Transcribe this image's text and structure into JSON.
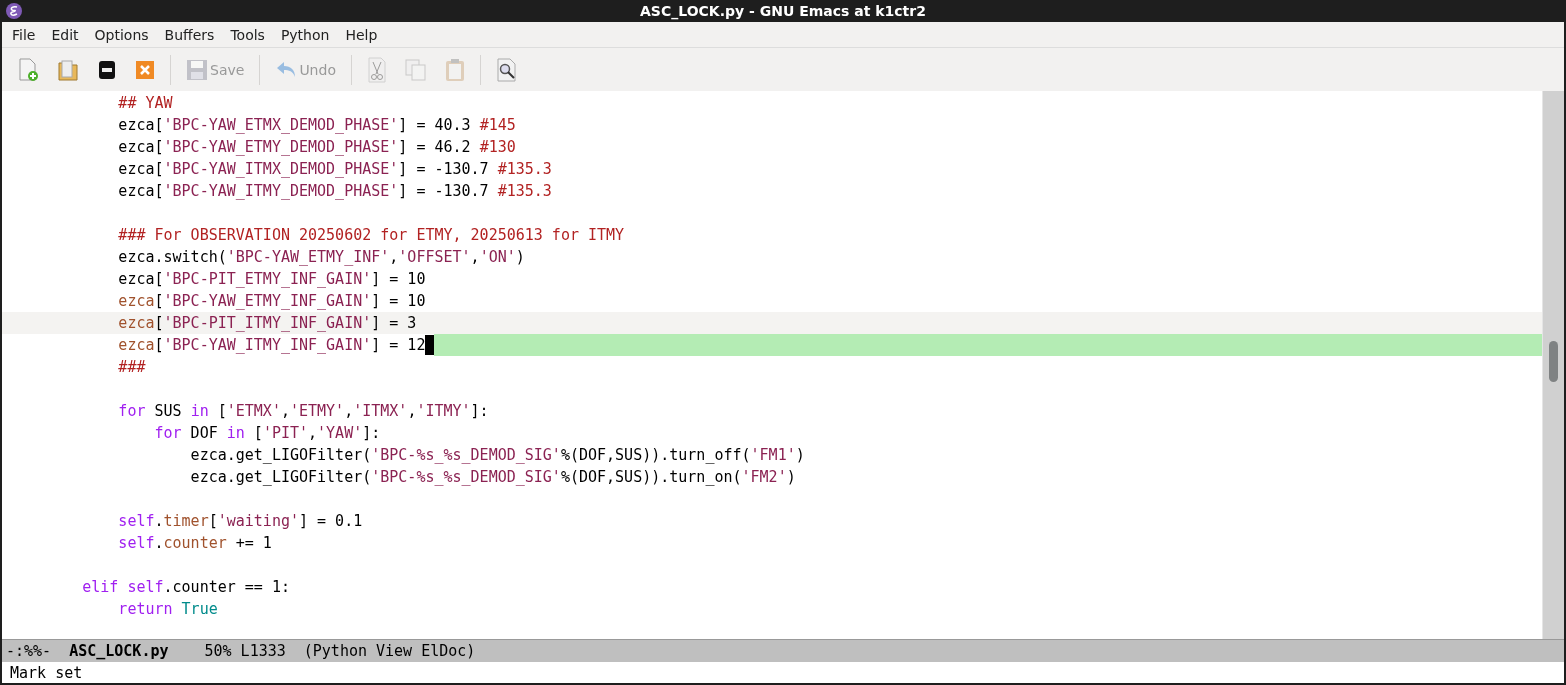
{
  "window": {
    "title": "ASC_LOCK.py - GNU Emacs at k1ctr2"
  },
  "menu": [
    "File",
    "Edit",
    "Options",
    "Buffers",
    "Tools",
    "Python",
    "Help"
  ],
  "toolbar": [
    {
      "kind": "new-file",
      "disabled": false
    },
    {
      "kind": "open",
      "disabled": false
    },
    {
      "kind": "dired",
      "disabled": false
    },
    {
      "kind": "close",
      "disabled": false
    },
    {
      "kind": "sep"
    },
    {
      "kind": "save",
      "label": "Save",
      "disabled": true
    },
    {
      "kind": "sep"
    },
    {
      "kind": "undo",
      "label": "Undo",
      "disabled": true
    },
    {
      "kind": "sep"
    },
    {
      "kind": "cut",
      "disabled": true
    },
    {
      "kind": "copy",
      "disabled": true
    },
    {
      "kind": "paste",
      "disabled": true
    },
    {
      "kind": "sep"
    },
    {
      "kind": "search",
      "disabled": false
    }
  ],
  "lines": [
    {
      "kind": "code",
      "tokens": [
        {
          "kind": "comment",
          "text": "            ## YAW"
        }
      ]
    },
    {
      "kind": "code",
      "tokens": [
        {
          "kind": "plain",
          "text": "            ezca["
        },
        {
          "kind": "string",
          "text": "'BPC-YAW_ETMX_DEMOD_PHASE'"
        },
        {
          "kind": "plain",
          "text": "] = 40.3 "
        },
        {
          "kind": "comment",
          "text": "#145"
        }
      ]
    },
    {
      "kind": "code",
      "tokens": [
        {
          "kind": "plain",
          "text": "            ezca["
        },
        {
          "kind": "string",
          "text": "'BPC-YAW_ETMY_DEMOD_PHASE'"
        },
        {
          "kind": "plain",
          "text": "] = 46.2 "
        },
        {
          "kind": "comment",
          "text": "#130"
        }
      ]
    },
    {
      "kind": "code",
      "tokens": [
        {
          "kind": "plain",
          "text": "            ezca["
        },
        {
          "kind": "string",
          "text": "'BPC-YAW_ITMX_DEMOD_PHASE'"
        },
        {
          "kind": "plain",
          "text": "] = -130.7 "
        },
        {
          "kind": "comment",
          "text": "#135.3"
        }
      ]
    },
    {
      "kind": "code",
      "tokens": [
        {
          "kind": "plain",
          "text": "            ezca["
        },
        {
          "kind": "string",
          "text": "'BPC-YAW_ITMY_DEMOD_PHASE'"
        },
        {
          "kind": "plain",
          "text": "] = -130.7 "
        },
        {
          "kind": "comment",
          "text": "#135.3"
        }
      ]
    },
    {
      "kind": "blank"
    },
    {
      "kind": "code",
      "tokens": [
        {
          "kind": "comment",
          "text": "            ### For OBSERVATION 20250602 for ETMY, 20250613 for ITMY"
        }
      ]
    },
    {
      "kind": "code",
      "tokens": [
        {
          "kind": "plain",
          "text": "            ezca.switch("
        },
        {
          "kind": "string",
          "text": "'BPC-YAW_ETMY_INF'"
        },
        {
          "kind": "plain",
          "text": ","
        },
        {
          "kind": "string",
          "text": "'OFFSET'"
        },
        {
          "kind": "plain",
          "text": ","
        },
        {
          "kind": "string",
          "text": "'ON'"
        },
        {
          "kind": "plain",
          "text": ")"
        }
      ]
    },
    {
      "kind": "code",
      "tokens": [
        {
          "kind": "plain",
          "text": "            ezca["
        },
        {
          "kind": "string",
          "text": "'BPC-PIT_ETMY_INF_GAIN'"
        },
        {
          "kind": "plain",
          "text": "] = 10"
        }
      ]
    },
    {
      "kind": "code",
      "tokens": [
        {
          "kind": "variable",
          "text": "            ezca"
        },
        {
          "kind": "plain",
          "text": "["
        },
        {
          "kind": "string",
          "text": "'BPC-YAW_ETMY_INF_GAIN'"
        },
        {
          "kind": "plain",
          "text": "] = 10"
        }
      ]
    },
    {
      "kind": "code",
      "in_region": true,
      "tokens": [
        {
          "kind": "variable",
          "text": "            ezca"
        },
        {
          "kind": "plain",
          "text": "["
        },
        {
          "kind": "string",
          "text": "'BPC-PIT_ITMY_INF_GAIN'"
        },
        {
          "kind": "plain",
          "text": "] = 3"
        }
      ]
    },
    {
      "kind": "code",
      "current_line": true,
      "cursor": true,
      "tokens": [
        {
          "kind": "variable",
          "text": "            ezca"
        },
        {
          "kind": "plain",
          "text": "["
        },
        {
          "kind": "string",
          "text": "'BPC-YAW_ITMY_INF_GAIN'"
        },
        {
          "kind": "plain",
          "text": "] = 12"
        }
      ]
    },
    {
      "kind": "code",
      "tokens": [
        {
          "kind": "comment",
          "text": "            ###"
        }
      ]
    },
    {
      "kind": "blank"
    },
    {
      "kind": "code",
      "tokens": [
        {
          "kind": "keyword",
          "text": "            for"
        },
        {
          "kind": "plain",
          "text": " SUS "
        },
        {
          "kind": "keyword",
          "text": "in"
        },
        {
          "kind": "plain",
          "text": " ["
        },
        {
          "kind": "string",
          "text": "'ETMX'"
        },
        {
          "kind": "plain",
          "text": ","
        },
        {
          "kind": "string",
          "text": "'ETMY'"
        },
        {
          "kind": "plain",
          "text": ","
        },
        {
          "kind": "string",
          "text": "'ITMX'"
        },
        {
          "kind": "plain",
          "text": ","
        },
        {
          "kind": "string",
          "text": "'ITMY'"
        },
        {
          "kind": "plain",
          "text": "]:"
        }
      ]
    },
    {
      "kind": "code",
      "tokens": [
        {
          "kind": "keyword",
          "text": "                for"
        },
        {
          "kind": "plain",
          "text": " DOF "
        },
        {
          "kind": "keyword",
          "text": "in"
        },
        {
          "kind": "plain",
          "text": " ["
        },
        {
          "kind": "string",
          "text": "'PIT'"
        },
        {
          "kind": "plain",
          "text": ","
        },
        {
          "kind": "string",
          "text": "'YAW'"
        },
        {
          "kind": "plain",
          "text": "]:"
        }
      ]
    },
    {
      "kind": "code",
      "tokens": [
        {
          "kind": "plain",
          "text": "                    ezca.get_LIGOFilter("
        },
        {
          "kind": "string",
          "text": "'BPC-%s_%s_DEMOD_SIG'"
        },
        {
          "kind": "plain",
          "text": "%(DOF,SUS)).turn_off("
        },
        {
          "kind": "string",
          "text": "'FM1'"
        },
        {
          "kind": "plain",
          "text": ")"
        }
      ]
    },
    {
      "kind": "code",
      "tokens": [
        {
          "kind": "plain",
          "text": "                    ezca.get_LIGOFilter("
        },
        {
          "kind": "string",
          "text": "'BPC-%s_%s_DEMOD_SIG'"
        },
        {
          "kind": "plain",
          "text": "%(DOF,SUS)).turn_on("
        },
        {
          "kind": "string",
          "text": "'FM2'"
        },
        {
          "kind": "plain",
          "text": ")"
        }
      ]
    },
    {
      "kind": "blank"
    },
    {
      "kind": "code",
      "tokens": [
        {
          "kind": "keyword",
          "text": "            self"
        },
        {
          "kind": "plain",
          "text": "."
        },
        {
          "kind": "variable",
          "text": "timer"
        },
        {
          "kind": "plain",
          "text": "["
        },
        {
          "kind": "string",
          "text": "'waiting'"
        },
        {
          "kind": "plain",
          "text": "] = 0.1"
        }
      ]
    },
    {
      "kind": "code",
      "tokens": [
        {
          "kind": "keyword",
          "text": "            self"
        },
        {
          "kind": "plain",
          "text": "."
        },
        {
          "kind": "variable",
          "text": "counter"
        },
        {
          "kind": "plain",
          "text": " += 1"
        }
      ]
    },
    {
      "kind": "blank"
    },
    {
      "kind": "code",
      "tokens": [
        {
          "kind": "keyword",
          "text": "        elif self"
        },
        {
          "kind": "plain",
          "text": ".counter == 1:"
        }
      ]
    },
    {
      "kind": "code",
      "tokens": [
        {
          "kind": "keyword",
          "text": "            return "
        },
        {
          "kind": "constant",
          "text": "True"
        }
      ]
    }
  ],
  "mode_line": {
    "status": "-:%%-",
    "buffer": "ASC_LOCK.py",
    "position": "50% L1333",
    "modes": "(Python View ElDoc)"
  },
  "echo_area": "Mark set"
}
